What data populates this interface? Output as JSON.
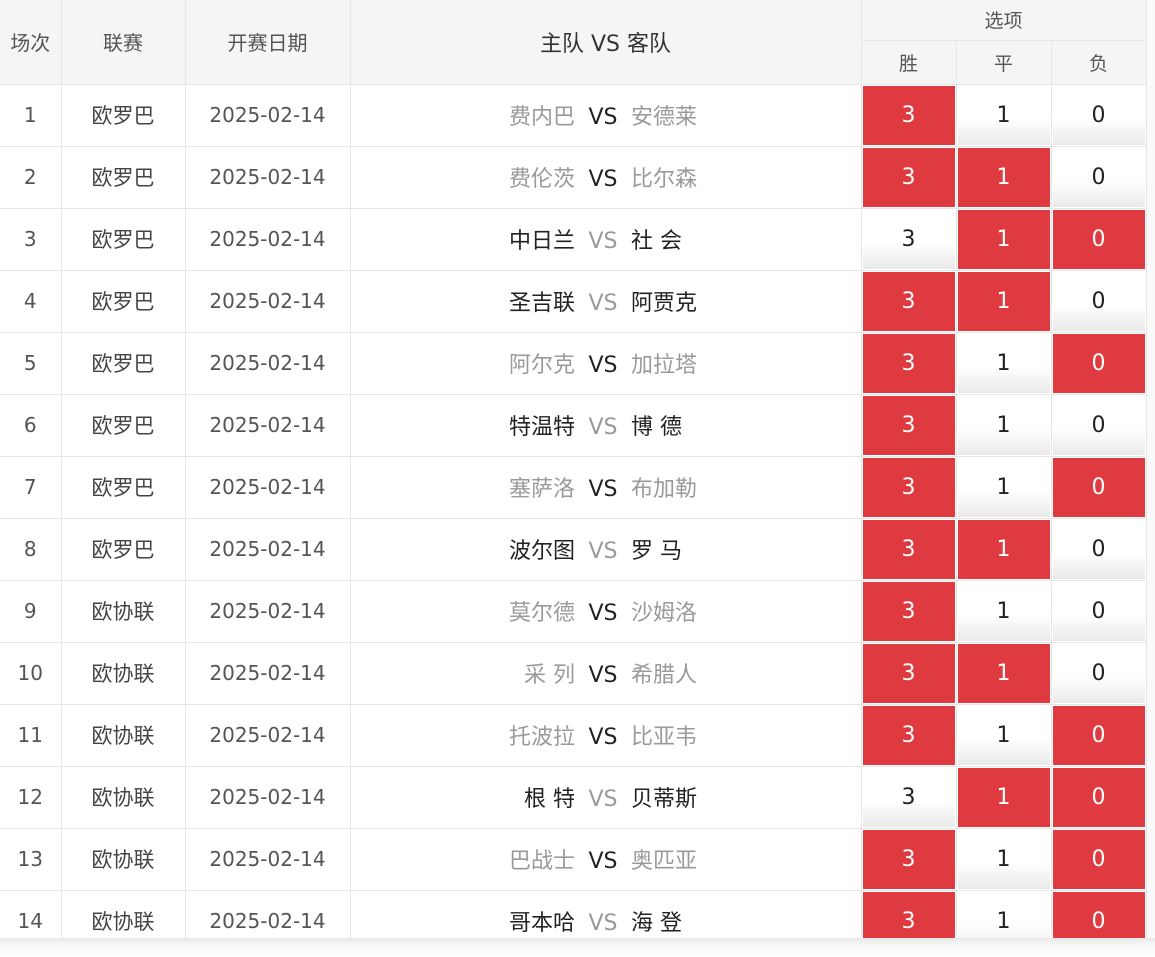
{
  "header": {
    "col_no": "场次",
    "col_league": "联赛",
    "col_date": "开赛日期",
    "col_match": "主队 VS 客队",
    "col_options": "选项",
    "opt_win": "胜",
    "opt_draw": "平",
    "opt_lose": "负"
  },
  "vs_label": "VS",
  "rows": [
    {
      "no": "1",
      "league": "欧罗巴",
      "date": "2025-02-14",
      "home": "费内巴",
      "away": "安德莱",
      "highlight": "away",
      "w": "3",
      "d": "1",
      "l": "0",
      "sel": [
        true,
        false,
        false
      ]
    },
    {
      "no": "2",
      "league": "欧罗巴",
      "date": "2025-02-14",
      "home": "费伦茨",
      "away": "比尔森",
      "highlight": "away",
      "w": "3",
      "d": "1",
      "l": "0",
      "sel": [
        true,
        true,
        false
      ]
    },
    {
      "no": "3",
      "league": "欧罗巴",
      "date": "2025-02-14",
      "home": "中日兰",
      "away": "社 会",
      "highlight": "home",
      "w": "3",
      "d": "1",
      "l": "0",
      "sel": [
        false,
        true,
        true
      ]
    },
    {
      "no": "4",
      "league": "欧罗巴",
      "date": "2025-02-14",
      "home": "圣吉联",
      "away": "阿贾克",
      "highlight": "home",
      "w": "3",
      "d": "1",
      "l": "0",
      "sel": [
        true,
        true,
        false
      ]
    },
    {
      "no": "5",
      "league": "欧罗巴",
      "date": "2025-02-14",
      "home": "阿尔克",
      "away": "加拉塔",
      "highlight": "away",
      "w": "3",
      "d": "1",
      "l": "0",
      "sel": [
        true,
        false,
        true
      ]
    },
    {
      "no": "6",
      "league": "欧罗巴",
      "date": "2025-02-14",
      "home": "特温特",
      "away": "博 德",
      "highlight": "home",
      "w": "3",
      "d": "1",
      "l": "0",
      "sel": [
        true,
        false,
        false
      ]
    },
    {
      "no": "7",
      "league": "欧罗巴",
      "date": "2025-02-14",
      "home": "塞萨洛",
      "away": "布加勒",
      "highlight": "away",
      "w": "3",
      "d": "1",
      "l": "0",
      "sel": [
        true,
        false,
        true
      ]
    },
    {
      "no": "8",
      "league": "欧罗巴",
      "date": "2025-02-14",
      "home": "波尔图",
      "away": "罗 马",
      "highlight": "home",
      "w": "3",
      "d": "1",
      "l": "0",
      "sel": [
        true,
        true,
        false
      ]
    },
    {
      "no": "9",
      "league": "欧协联",
      "date": "2025-02-14",
      "home": "莫尔德",
      "away": "沙姆洛",
      "highlight": "away",
      "w": "3",
      "d": "1",
      "l": "0",
      "sel": [
        true,
        false,
        false
      ]
    },
    {
      "no": "10",
      "league": "欧协联",
      "date": "2025-02-14",
      "home": "采 列",
      "away": "希腊人",
      "highlight": "away",
      "w": "3",
      "d": "1",
      "l": "0",
      "sel": [
        true,
        true,
        false
      ]
    },
    {
      "no": "11",
      "league": "欧协联",
      "date": "2025-02-14",
      "home": "托波拉",
      "away": "比亚韦",
      "highlight": "away",
      "w": "3",
      "d": "1",
      "l": "0",
      "sel": [
        true,
        false,
        true
      ]
    },
    {
      "no": "12",
      "league": "欧协联",
      "date": "2025-02-14",
      "home": "根 特",
      "away": "贝蒂斯",
      "highlight": "home",
      "w": "3",
      "d": "1",
      "l": "0",
      "sel": [
        false,
        true,
        true
      ]
    },
    {
      "no": "13",
      "league": "欧协联",
      "date": "2025-02-14",
      "home": "巴战士",
      "away": "奥匹亚",
      "highlight": "away",
      "w": "3",
      "d": "1",
      "l": "0",
      "sel": [
        true,
        false,
        true
      ]
    },
    {
      "no": "14",
      "league": "欧协联",
      "date": "2025-02-14",
      "home": "哥本哈",
      "away": "海 登",
      "highlight": "home",
      "w": "3",
      "d": "1",
      "l": "0",
      "sel": [
        true,
        false,
        true
      ]
    }
  ],
  "colors": {
    "selected": "#df3a3f",
    "muted_team": "#9a9a9a",
    "normal_team": "#222222"
  }
}
